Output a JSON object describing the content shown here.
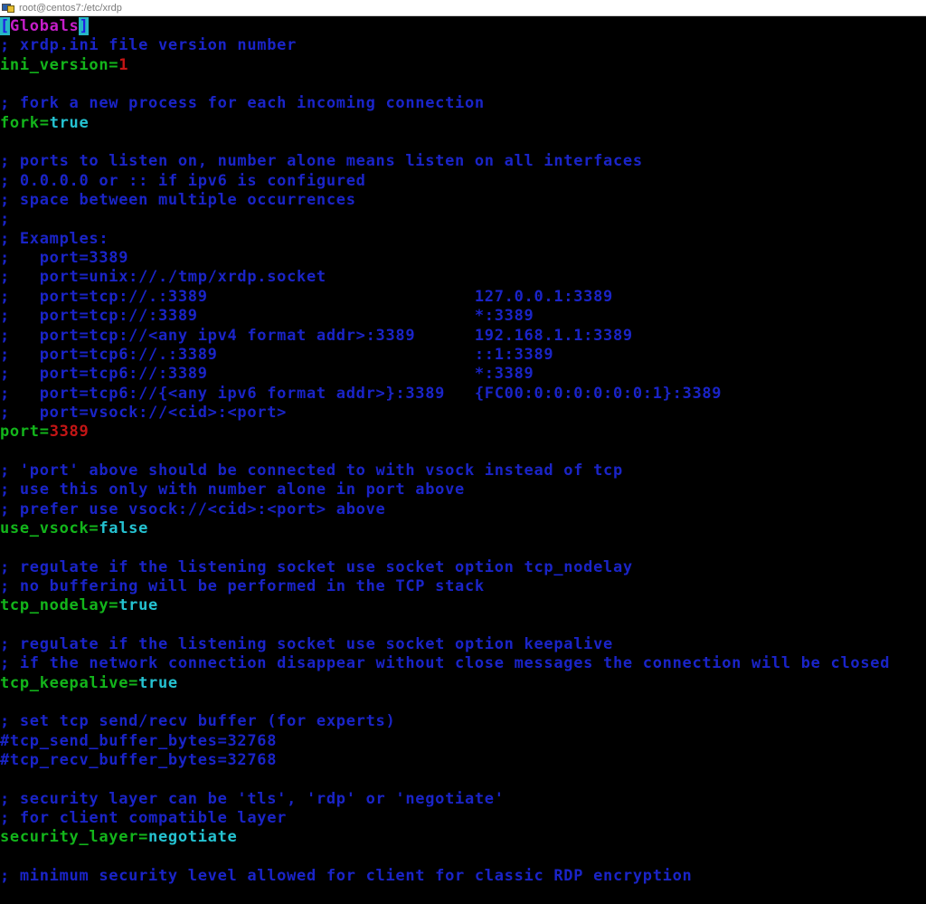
{
  "window": {
    "title": "root@centos7:/etc/xrdp"
  },
  "colors": {
    "comment": "#1a24c8",
    "key": "#13b51b",
    "number": "#c41515",
    "boolean": "#25c2d1",
    "section": "#c51ec9",
    "background": "#000000"
  },
  "lines": [
    {
      "type": "section",
      "open": "[",
      "name": "Globals",
      "close": "]"
    },
    {
      "type": "comment",
      "text": "; xrdp.ini file version number"
    },
    {
      "type": "kv",
      "key": "ini_version=",
      "value": "1",
      "vtype": "num"
    },
    {
      "type": "blank",
      "text": ""
    },
    {
      "type": "comment",
      "text": "; fork a new process for each incoming connection"
    },
    {
      "type": "kv",
      "key": "fork=",
      "value": "true",
      "vtype": "bool"
    },
    {
      "type": "blank",
      "text": ""
    },
    {
      "type": "comment",
      "text": "; ports to listen on, number alone means listen on all interfaces"
    },
    {
      "type": "comment",
      "text": "; 0.0.0.0 or :: if ipv6 is configured"
    },
    {
      "type": "comment",
      "text": "; space between multiple occurrences"
    },
    {
      "type": "comment",
      "text": ";"
    },
    {
      "type": "comment",
      "text": "; Examples:"
    },
    {
      "type": "comment",
      "text": ";   port=3389"
    },
    {
      "type": "comment",
      "text": ";   port=unix://./tmp/xrdp.socket"
    },
    {
      "type": "comment",
      "text": ";   port=tcp://.:3389                           127.0.0.1:3389"
    },
    {
      "type": "comment",
      "text": ";   port=tcp://:3389                            *:3389"
    },
    {
      "type": "comment",
      "text": ";   port=tcp://<any ipv4 format addr>:3389      192.168.1.1:3389"
    },
    {
      "type": "comment",
      "text": ";   port=tcp6://.:3389                          ::1:3389"
    },
    {
      "type": "comment",
      "text": ";   port=tcp6://:3389                           *:3389"
    },
    {
      "type": "comment",
      "text": ";   port=tcp6://{<any ipv6 format addr>}:3389   {FC00:0:0:0:0:0:0:1}:3389"
    },
    {
      "type": "comment",
      "text": ";   port=vsock://<cid>:<port>"
    },
    {
      "type": "kv",
      "key": "port=",
      "value": "3389",
      "vtype": "num"
    },
    {
      "type": "blank",
      "text": ""
    },
    {
      "type": "comment",
      "text": "; 'port' above should be connected to with vsock instead of tcp"
    },
    {
      "type": "comment",
      "text": "; use this only with number alone in port above"
    },
    {
      "type": "comment",
      "text": "; prefer use vsock://<cid>:<port> above"
    },
    {
      "type": "kv",
      "key": "use_vsock=",
      "value": "false",
      "vtype": "bool"
    },
    {
      "type": "blank",
      "text": ""
    },
    {
      "type": "comment",
      "text": "; regulate if the listening socket use socket option tcp_nodelay"
    },
    {
      "type": "comment",
      "text": "; no buffering will be performed in the TCP stack"
    },
    {
      "type": "kv",
      "key": "tcp_nodelay=",
      "value": "true",
      "vtype": "bool"
    },
    {
      "type": "blank",
      "text": ""
    },
    {
      "type": "comment",
      "text": "; regulate if the listening socket use socket option keepalive"
    },
    {
      "type": "comment",
      "text": "; if the network connection disappear without close messages the connection will be closed"
    },
    {
      "type": "kv",
      "key": "tcp_keepalive=",
      "value": "true",
      "vtype": "bool"
    },
    {
      "type": "blank",
      "text": ""
    },
    {
      "type": "comment",
      "text": "; set tcp send/recv buffer (for experts)"
    },
    {
      "type": "comment",
      "text": "#tcp_send_buffer_bytes=32768"
    },
    {
      "type": "comment",
      "text": "#tcp_recv_buffer_bytes=32768"
    },
    {
      "type": "blank",
      "text": ""
    },
    {
      "type": "comment",
      "text": "; security layer can be 'tls', 'rdp' or 'negotiate'"
    },
    {
      "type": "comment",
      "text": "; for client compatible layer"
    },
    {
      "type": "kv",
      "key": "security_layer=",
      "value": "negotiate",
      "vtype": "bool"
    },
    {
      "type": "blank",
      "text": ""
    },
    {
      "type": "comment",
      "text": "; minimum security level allowed for client for classic RDP encryption"
    }
  ]
}
